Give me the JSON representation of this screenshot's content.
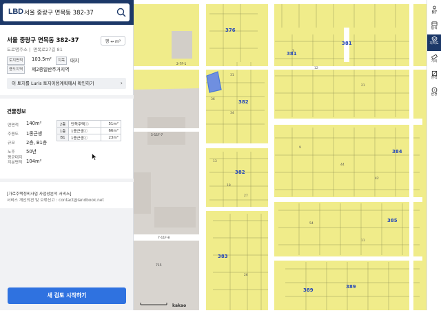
{
  "search": {
    "logo": "LBD",
    "query": "서울 중랑구 면목동 382-37"
  },
  "parcel": {
    "title": "서울 중랑구 면목동 382-37",
    "road_label": "도로명주소",
    "road_address": "면목로27길 81",
    "unit_label": "평 ↔ m²",
    "area_chip": "토지면적",
    "area_value": "103.5m²",
    "landuse_chip": "지목",
    "landuse_value": "대지",
    "zone_chip": "용도지역",
    "zone_value": "제2종일반주거지역",
    "luris_label": "이 토지를 Luris 토지이용계획에서 확인하기"
  },
  "building": {
    "title": "건물정보",
    "rows": [
      {
        "label": "연면적",
        "value": "140m²"
      },
      {
        "label": "주용도",
        "value": "1종근생"
      },
      {
        "label": "규모",
        "value": "2층, B1층"
      },
      {
        "label": "노후",
        "value": "50년"
      },
      {
        "label": "평균대지 지분면적",
        "value": "104m²"
      }
    ],
    "floors": [
      {
        "floor": "2층",
        "use": "단독주택ⓘ",
        "area": "51m²"
      },
      {
        "floor": "1층",
        "use": "1종근생ⓘ",
        "area": "66m²"
      },
      {
        "floor": "B1",
        "use": "1종근생ⓘ",
        "area": "23m²"
      }
    ]
  },
  "service": {
    "line1": "[가로주택정비사업 사업성분석 서비스]",
    "line2": "서비스 개선의견 및 오류신고 : contact@landbook.net"
  },
  "cta": {
    "label": "새 검토 시작하기"
  },
  "map": {
    "blocks": [
      "376",
      "381",
      "381",
      "382",
      "382",
      "384",
      "383",
      "385",
      "389",
      "389"
    ],
    "labels": [
      "2-7F-1",
      "5-11F-7",
      "7-11F-8",
      "715",
      "kakao"
    ],
    "highlight_color": "#4a78d6",
    "parcel_color": "#f0ec8a"
  },
  "rail": {
    "items": [
      {
        "label": "MY",
        "icon": "user-icon"
      },
      {
        "label": "탐색",
        "icon": "explore-icon"
      },
      {
        "label": "지적도",
        "icon": "layers-icon"
      },
      {
        "label": "거리",
        "icon": "ruler-icon"
      },
      {
        "label": "면적",
        "icon": "area-icon"
      },
      {
        "label": "반경",
        "icon": "radius-icon"
      }
    ]
  },
  "colors": {
    "primary": "#1c3868",
    "button": "#2f72e0",
    "map_road": "#ffffff"
  }
}
